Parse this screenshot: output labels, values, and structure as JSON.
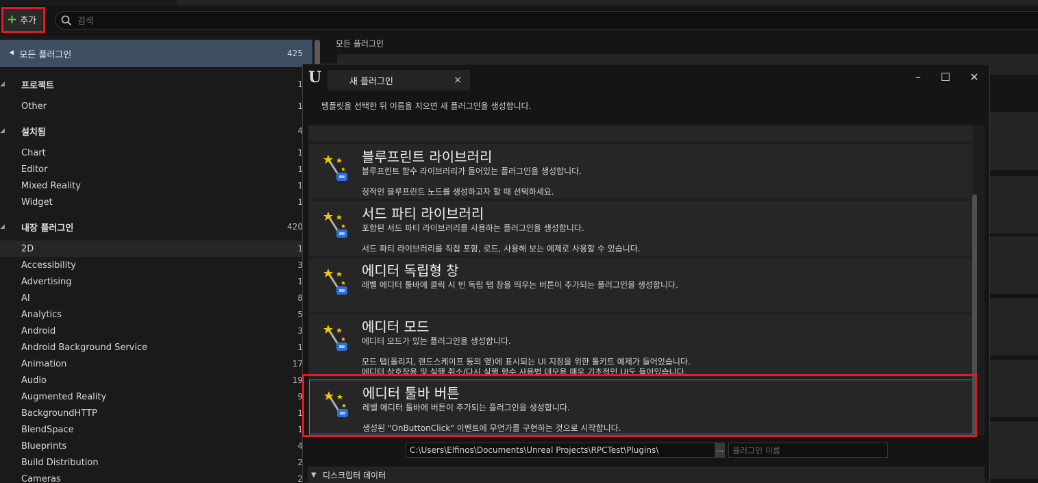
{
  "toolbar": {
    "add_label": "추가",
    "search_placeholder": "검색"
  },
  "sidebar": {
    "all": {
      "label": "모든 플러그인",
      "count": "425"
    },
    "rows": [
      {
        "label": "프로젝트",
        "count": "1",
        "head": true
      },
      {
        "label": "Other",
        "count": "1"
      },
      {
        "label": "설치됨",
        "count": "4",
        "head": true
      },
      {
        "label": "Chart",
        "count": "1"
      },
      {
        "label": "Editor",
        "count": "1"
      },
      {
        "label": "Mixed Reality",
        "count": "1"
      },
      {
        "label": "Widget",
        "count": "1"
      },
      {
        "label": "내장 플러그인",
        "count": "420",
        "head": true
      },
      {
        "label": "2D",
        "count": "1",
        "sel": true
      },
      {
        "label": "Accessibility",
        "count": "3"
      },
      {
        "label": "Advertising",
        "count": "1"
      },
      {
        "label": "AI",
        "count": "8"
      },
      {
        "label": "Analytics",
        "count": "5"
      },
      {
        "label": "Android",
        "count": "3"
      },
      {
        "label": "Android Background Service",
        "count": "1"
      },
      {
        "label": "Animation",
        "count": "17"
      },
      {
        "label": "Audio",
        "count": "19"
      },
      {
        "label": "Augmented Reality",
        "count": "9"
      },
      {
        "label": "BackgroundHTTP",
        "count": "1"
      },
      {
        "label": "BlendSpace",
        "count": "1"
      },
      {
        "label": "Blueprints",
        "count": "4"
      },
      {
        "label": "Build Distribution",
        "count": "2"
      },
      {
        "label": "Cameras",
        "count": "2"
      }
    ]
  },
  "main": {
    "title": "모든 플러그인"
  },
  "dialog": {
    "tab_title": "새 플러그인",
    "description": "템플릿을 선택한 뒤 이름을 지으면 새 플러그인을 생성합니다.",
    "templates": [
      {
        "name": "블루프린트 라이브러리",
        "d1": "블루프린트 함수 라이브러리가 들어있는 플러그인을 생성합니다.",
        "d2": "정적인 블루프린트 노드를 생성하고자 할 때 선택하세요.",
        "d3": ""
      },
      {
        "name": "서드 파티 라이브러리",
        "d1": "포함된 서드 파티 라이브러리를 사용하는 플러그인을 생성합니다.",
        "d2": "서드 파티 라이브러리를 직접 포함, 로드, 사용해 보는 예제로 사용할 수 있습니다.",
        "d3": ""
      },
      {
        "name": "에디터 독립형 창",
        "d1": "레벨 에디터 툴바에 클릭 시 빈 독립 탭 창을 띄우는 버튼이 추가되는 플러그인을 생성합니다.",
        "d2": "",
        "d3": ""
      },
      {
        "name": "에디터 모드",
        "d1": "에디터 모드가 있는 플러그인을 생성합니다.",
        "d2": "모드 탭(폴리지, 랜드스케이프 등의 옆)에 표시되는 UI 지정을 위한 툴키트 예제가 들어있습니다.",
        "d3": "에디터 상호작용 및 실행 취소/다시 실행 함수 사용법 데모용 매우 기초적인 UI도 들어있습니다."
      },
      {
        "name": "에디터 툴바 버튼",
        "d1": "레벨 에디터 툴바에 버튼이 추가되는 플러그인을 생성합니다.",
        "d2": "생성된 \"OnButtonClick\" 이벤트에 무언가를 구현하는 것으로 시작합니다.",
        "d3": ""
      }
    ],
    "path_value": "C:\\Users\\Elfinos\\Documents\\Unreal Projects\\RPCTest\\Plugins\\",
    "browse_label": "...",
    "name_placeholder": "플러그인 이름",
    "descriptor_label": "디스크립터 데이터"
  },
  "colors": {
    "highlight": "#e01b24",
    "selected_row": "#3e4f63",
    "accent_plus": "#4fc24f"
  }
}
